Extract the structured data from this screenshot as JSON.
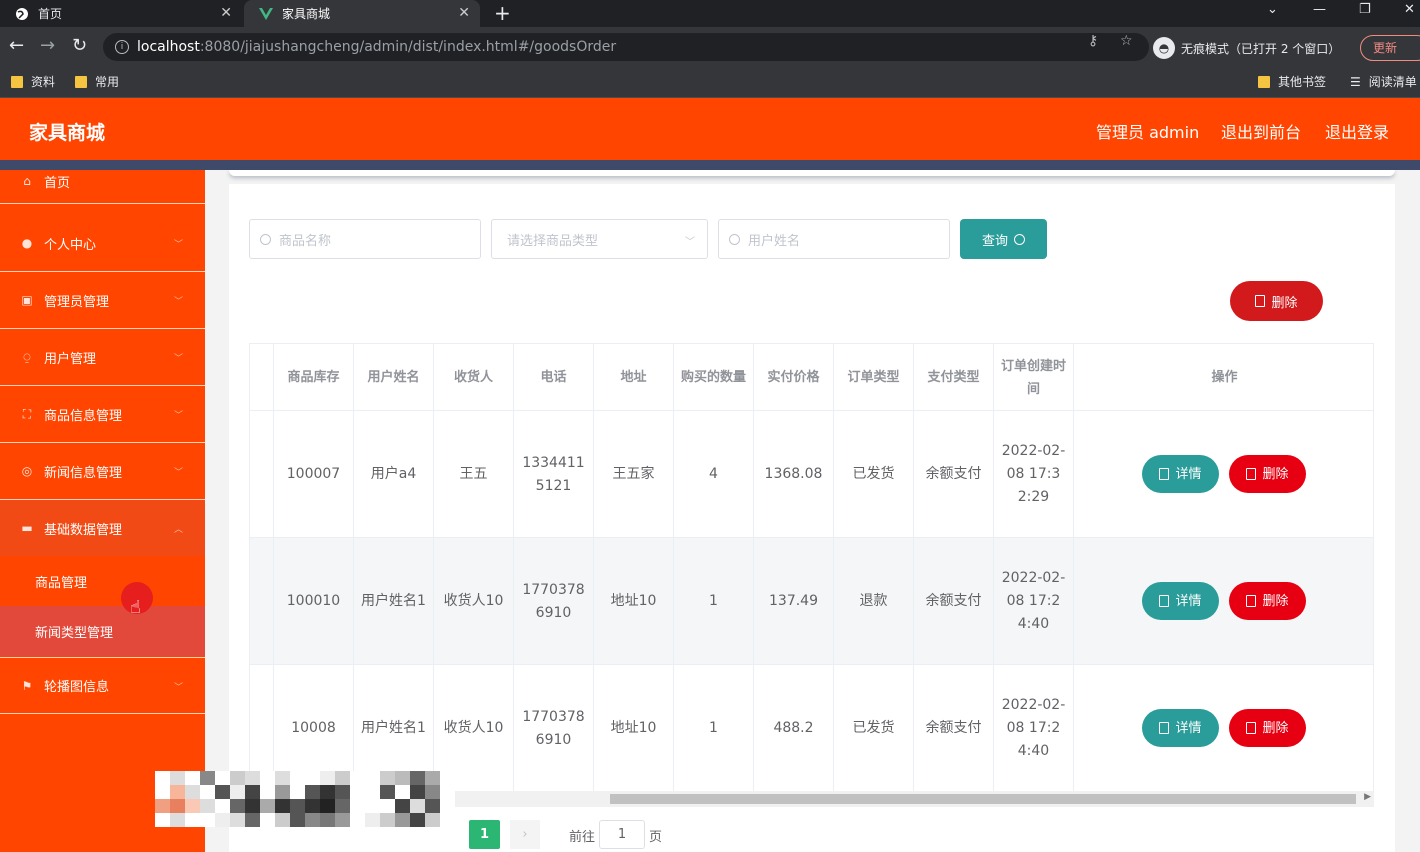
{
  "browser": {
    "tabs": [
      {
        "title": "首页",
        "icon": "globe-icon",
        "active": false
      },
      {
        "title": "家具商城",
        "icon": "vue-icon",
        "active": true
      }
    ],
    "url_host": "localhost",
    "url_rest": ":8080/jiajushangcheng/admin/dist/index.html#/goodsOrder",
    "incognito_label": "无痕模式（已打开 2 个窗口）",
    "update_label": "更新",
    "bookmarks_left": [
      "资料",
      "常用"
    ],
    "bookmarks_right": [
      "其他书签",
      "阅读清单"
    ]
  },
  "header": {
    "brand": "家具商城",
    "links": [
      "管理员 admin",
      "退出到前台",
      "退出登录"
    ]
  },
  "sidebar": {
    "items": [
      {
        "label": "首页",
        "icon": "home-icon"
      },
      {
        "label": "个人中心",
        "icon": "user-icon"
      },
      {
        "label": "管理员管理",
        "icon": "briefcase-icon"
      },
      {
        "label": "用户管理",
        "icon": "microphone-icon"
      },
      {
        "label": "商品信息管理",
        "icon": "frame-icon"
      },
      {
        "label": "新闻信息管理",
        "icon": "target-icon"
      },
      {
        "label": "基础数据管理",
        "icon": "folder-icon"
      },
      {
        "label": "轮播图信息",
        "icon": "flag-icon"
      }
    ],
    "submenu": [
      "商品管理",
      "新闻类型管理"
    ]
  },
  "search": {
    "goods_name_placeholder": "商品名称",
    "goods_type_placeholder": "请选择商品类型",
    "user_name_placeholder": "用户姓名",
    "query_label": "查询"
  },
  "actions": {
    "bulk_delete_label": "删除"
  },
  "table": {
    "headers": [
      "商品库存",
      "用户姓名",
      "收货人",
      "电话",
      "地址",
      "购买的数量",
      "实付价格",
      "订单类型",
      "支付类型",
      "订单创建时间",
      "操作"
    ],
    "rows": [
      [
        "100007",
        "用户a4",
        "王五",
        "13344115121",
        "王五家",
        "4",
        "1368.08",
        "已发货",
        "余额支付",
        "2022-02-08 17:32:29"
      ],
      [
        "100010",
        "用户姓名1",
        "收货人10",
        "17703786910",
        "地址10",
        "1",
        "137.49",
        "退款",
        "余额支付",
        "2022-02-08 17:24:40"
      ],
      [
        "10008",
        "用户姓名1",
        "收货人10",
        "17703786910",
        "地址10",
        "1",
        "488.2",
        "已发货",
        "余额支付",
        "2022-02-08 17:24:40"
      ]
    ],
    "detail_label": "详情",
    "delete_label": "删除"
  },
  "pagination": {
    "current_page": "1",
    "goto_label": "前往",
    "goto_value": "1",
    "unit_label": "页"
  },
  "colors": {
    "brand": "#ff4500",
    "teal": "#2a9d9a",
    "danger": "#e60012",
    "page_active": "#2bb673"
  }
}
